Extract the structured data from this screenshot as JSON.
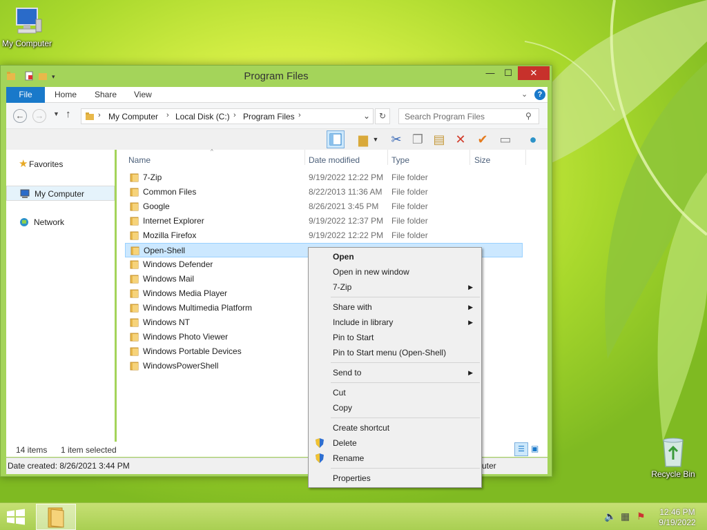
{
  "desktop": {
    "icons": [
      {
        "label": "My Computer",
        "icon": "computer-icon"
      },
      {
        "label": "Recycle Bin",
        "icon": "recycle-bin-icon"
      }
    ]
  },
  "window": {
    "title": "Program Files",
    "controls": {
      "minimize": "—",
      "maximize": "☐",
      "close": "✕"
    },
    "ribbon_tabs": [
      "File",
      "Home",
      "Share",
      "View"
    ],
    "address": {
      "crumbs": [
        "My Computer",
        "Local Disk (C:)",
        "Program Files"
      ],
      "search_placeholder": "Search Program Files"
    },
    "nav_pane": {
      "items": [
        "Favorites",
        "My Computer",
        "Network"
      ],
      "selected": "My Computer"
    },
    "columns": [
      "Name",
      "Date modified",
      "Type",
      "Size"
    ],
    "files": [
      {
        "name": "7-Zip",
        "date": "9/19/2022 12:22 PM",
        "type": "File folder"
      },
      {
        "name": "Common Files",
        "date": "8/22/2013 11:36 AM",
        "type": "File folder"
      },
      {
        "name": "Google",
        "date": "8/26/2021 3:45 PM",
        "type": "File folder"
      },
      {
        "name": "Internet Explorer",
        "date": "9/19/2022 12:37 PM",
        "type": "File folder"
      },
      {
        "name": "Mozilla Firefox",
        "date": "9/19/2022 12:22 PM",
        "type": "File folder"
      },
      {
        "name": "Open-Shell",
        "date": "",
        "type": ""
      },
      {
        "name": "Windows Defender",
        "date": "",
        "type": ""
      },
      {
        "name": "Windows Mail",
        "date": "",
        "type": ""
      },
      {
        "name": "Windows Media Player",
        "date": "",
        "type": ""
      },
      {
        "name": "Windows Multimedia Platform",
        "date": "",
        "type": ""
      },
      {
        "name": "Windows NT",
        "date": "",
        "type": ""
      },
      {
        "name": "Windows Photo Viewer",
        "date": "",
        "type": ""
      },
      {
        "name": "Windows Portable Devices",
        "date": "",
        "type": ""
      },
      {
        "name": "WindowsPowerShell",
        "date": "",
        "type": ""
      }
    ],
    "selected_file": "Open-Shell",
    "status": {
      "item_count": "14 items",
      "selection": "1 item selected"
    },
    "details": {
      "date_created": "Date created: 8/26/2021 3:44 PM",
      "right_text": "uter"
    }
  },
  "context_menu": {
    "groups": [
      [
        {
          "label": "Open",
          "bold": true
        },
        {
          "label": "Open in new window"
        },
        {
          "label": "7-Zip",
          "submenu": true
        }
      ],
      [
        {
          "label": "Share with",
          "submenu": true
        },
        {
          "label": "Include in library",
          "submenu": true
        },
        {
          "label": "Pin to Start"
        },
        {
          "label": "Pin to Start menu (Open-Shell)"
        }
      ],
      [
        {
          "label": "Send to",
          "submenu": true
        }
      ],
      [
        {
          "label": "Cut"
        },
        {
          "label": "Copy"
        }
      ],
      [
        {
          "label": "Create shortcut"
        },
        {
          "label": "Delete",
          "shield": true
        },
        {
          "label": "Rename",
          "shield": true
        }
      ],
      [
        {
          "label": "Properties"
        }
      ]
    ]
  },
  "taskbar": {
    "clock": {
      "time": "12:46 PM",
      "date": "9/19/2022"
    }
  },
  "colors": {
    "accent": "#1979ca",
    "selection": "#cce8ff",
    "close": "#c7312b"
  }
}
